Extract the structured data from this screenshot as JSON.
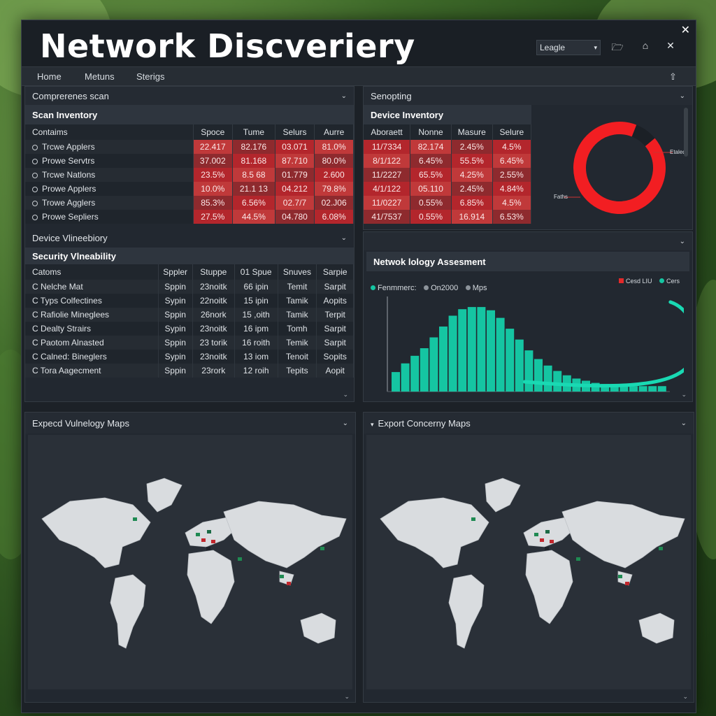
{
  "window": {
    "title": "Network Discveriery",
    "language_select": "Leagle"
  },
  "nav": {
    "items": [
      "Home",
      "Metuns",
      "Sterigs"
    ]
  },
  "panels": {
    "scan": {
      "header": "Comprerenes scan",
      "subtitle": "Scan Inventory",
      "columns": [
        "Contaims",
        "Spoce",
        "Tume",
        "Selurs",
        "Aurre"
      ],
      "rows": [
        [
          "Trcwe Applers",
          "22.417",
          "82.176",
          "03.071",
          "81.0%"
        ],
        [
          "Prowe Servtrs",
          "37.002",
          "81.168",
          "87.710",
          "80.0%"
        ],
        [
          "Trcwe Natlons",
          "23.5%",
          "8.5 68",
          "01.779",
          "2.600"
        ],
        [
          "Prowe Applers",
          "10.0%",
          "21.1 13",
          "04.212",
          "79.8%"
        ],
        [
          "Trowe Agglers",
          "85.3%",
          "6.56%",
          "02.7/7",
          "02.J06"
        ],
        [
          "Prowe Sepliers",
          "27.5%",
          "44.5%",
          "04.780",
          "6.08%"
        ]
      ]
    },
    "senopting": {
      "header": "Senopting",
      "subtitle": "Device Inventory",
      "columns": [
        "Aboraett",
        "Nonne",
        "Masure",
        "Selure"
      ],
      "rows": [
        [
          "11/7334",
          "82.174",
          "2.45%",
          "4.5%"
        ],
        [
          "8/1/122",
          "6.45%",
          "55.5%",
          "6.45%"
        ],
        [
          "11/2227",
          "65.5%",
          "4.25%",
          "2.55%"
        ],
        [
          "4/1/122",
          "05.110",
          "2.45%",
          "4.84%"
        ],
        [
          "11/0227",
          "0.55%",
          "6.85%",
          "4.5%"
        ],
        [
          "41/7537",
          "0.55%",
          "16.914",
          "6.53%"
        ]
      ],
      "donut_label_top": "Etaled",
      "donut_label_left": "Faths",
      "donut_fraction": 0.92,
      "donut_color": "#f21e22"
    },
    "vuln": {
      "header": "Device Vlineebiory",
      "subtitle": "Security Vlneability",
      "columns": [
        "Catoms",
        "Sppler",
        "Stuppe",
        "01 Spue",
        "Snuves",
        "Sarpie"
      ],
      "rows": [
        [
          "C Nelche Mat",
          "Sppin",
          "23noitk",
          "66 ipin",
          "Temit",
          "Sarpit"
        ],
        [
          "C Typs Colfectines",
          "Sypin",
          "22noitk",
          "15 ipin",
          "Tamik",
          "Aopits"
        ],
        [
          "C Rafiolie Mineglees",
          "Sppin",
          "26nork",
          "15 ,oith",
          "Tamik",
          "Terpit"
        ],
        [
          "C Dealty Strairs",
          "Sypin",
          "23noitk",
          "16 ipm",
          "Tomh",
          "Sarpit"
        ],
        [
          "C Paotom Alnasted",
          "Sppin",
          "23 torik",
          "16 roith",
          "Temik",
          "Sarpit"
        ],
        [
          "C Calned: Bineglers",
          "Sypin",
          "23noitk",
          "13 iom",
          "Tenoit",
          "Sopits"
        ],
        [
          "C Tora Aagecment",
          "Sppin",
          "23rork",
          "12 roih",
          "Tepits",
          "Aopit"
        ]
      ]
    },
    "topology": {
      "subtitle": "Netwok lology Assesment",
      "legend_left": [
        "Fenmmerc:",
        "On2000",
        "Mps"
      ],
      "legend_right": [
        "Cesd LIU",
        "Cers"
      ]
    },
    "map_left": {
      "header": "Expecd Vulnelogy Maps"
    },
    "map_right": {
      "header": "Export Concerny Maps"
    }
  },
  "chart_data": {
    "type": "bar",
    "title": "Netwok lology Assesment",
    "values": [
      18,
      26,
      33,
      40,
      50,
      60,
      70,
      76,
      78,
      78,
      75,
      68,
      58,
      48,
      38,
      30,
      24,
      19,
      15,
      12,
      10,
      8,
      7,
      6,
      5,
      5,
      5,
      5,
      5
    ],
    "trend_line": "curve rising at right edge",
    "ylim": [
      0,
      80
    ],
    "colors": {
      "bars": "#15c5a2",
      "line": "#19d9b3"
    }
  },
  "colors": {
    "accent_red": "#f21e22",
    "accent_teal": "#15c5a2",
    "panel_bg": "#222830"
  }
}
